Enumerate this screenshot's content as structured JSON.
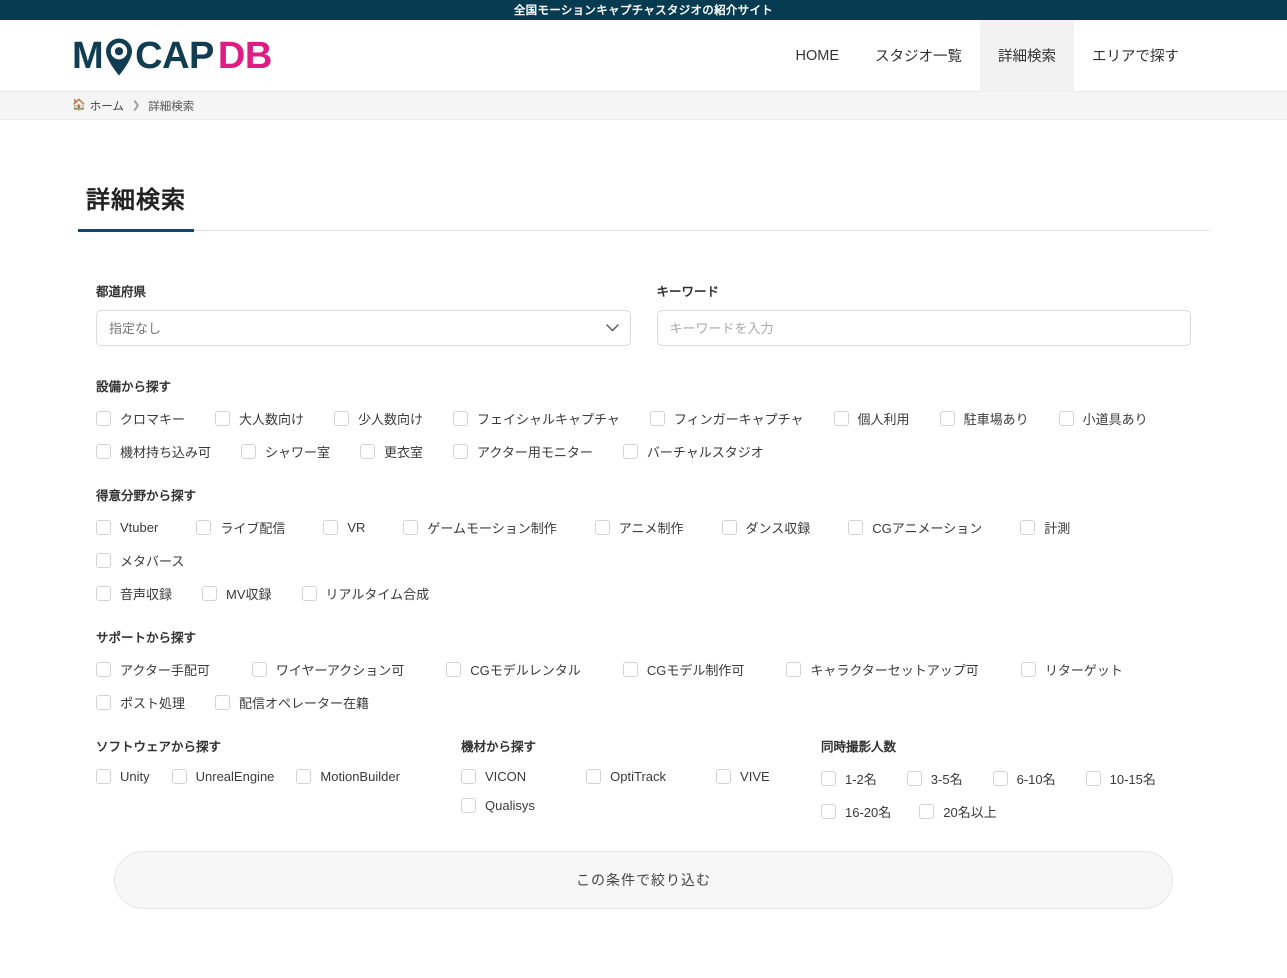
{
  "topbar": {
    "text": "全国モーションキャプチャスタジオの紹介サイト"
  },
  "logo": {
    "part1": "M",
    "part2": "CAP",
    "part3": "DB",
    "pin_icon": "map-pin-icon",
    "brand_dark": "#103d52",
    "brand_pink": "#e01b84"
  },
  "nav": {
    "items": [
      {
        "label": "HOME",
        "active": false
      },
      {
        "label": "スタジオ一覧",
        "active": false
      },
      {
        "label": "詳細検索",
        "active": true
      },
      {
        "label": "エリアで探す",
        "active": false
      }
    ]
  },
  "breadcrumb": {
    "home_icon": "home-icon",
    "home_label": "ホーム",
    "separator": "❯",
    "current": "詳細検索"
  },
  "page": {
    "title": "詳細検索",
    "accent_color": "#0e4a63"
  },
  "prefecture": {
    "label": "都道府県",
    "selected": "指定なし",
    "chevron_icon": "chevron-down-icon",
    "options": [
      "指定なし"
    ]
  },
  "keyword": {
    "label": "キーワード",
    "value": "",
    "placeholder": "キーワードを入力"
  },
  "groups": [
    {
      "title": "設備から探す",
      "items": [
        "クロマキー",
        "大人数向け",
        "少人数向け",
        "フェイシャルキャプチャ",
        "フィンガーキャプチャ",
        "個人利用",
        "駐車場あり",
        "小道具あり",
        "機材持ち込み可",
        "シャワー室",
        "更衣室",
        "アクター用モニター",
        "バーチャルスタジオ"
      ]
    },
    {
      "title": "得意分野から探す",
      "items": [
        "Vtuber",
        "ライブ配信",
        "VR",
        "ゲームモーション制作",
        "アニメ制作",
        "ダンス収録",
        "CGアニメーション",
        "計測",
        "メタバース",
        "音声収録",
        "MV収録",
        "リアルタイム合成"
      ]
    },
    {
      "title": "サポートから探す",
      "items": [
        "アクター手配可",
        "ワイヤーアクション可",
        "CGモデルレンタル",
        "CGモデル制作可",
        "キャラクターセットアップ可",
        "リターゲット",
        "ポスト処理",
        "配信オペレーター在籍"
      ]
    }
  ],
  "columns": [
    {
      "title": "ソフトウェアから探す",
      "items": [
        "Unity",
        "UnrealEngine",
        "MotionBuilder"
      ]
    },
    {
      "title": "機材から探す",
      "items": [
        "VICON",
        "OptiTrack",
        "VIVE",
        "Qualisys"
      ]
    },
    {
      "title": "同時撮影人数",
      "items": [
        "1-2名",
        "3-5名",
        "6-10名",
        "10-15名",
        "16-20名",
        "20名以上"
      ]
    }
  ],
  "submit": {
    "label": "この条件で絞り込む"
  }
}
